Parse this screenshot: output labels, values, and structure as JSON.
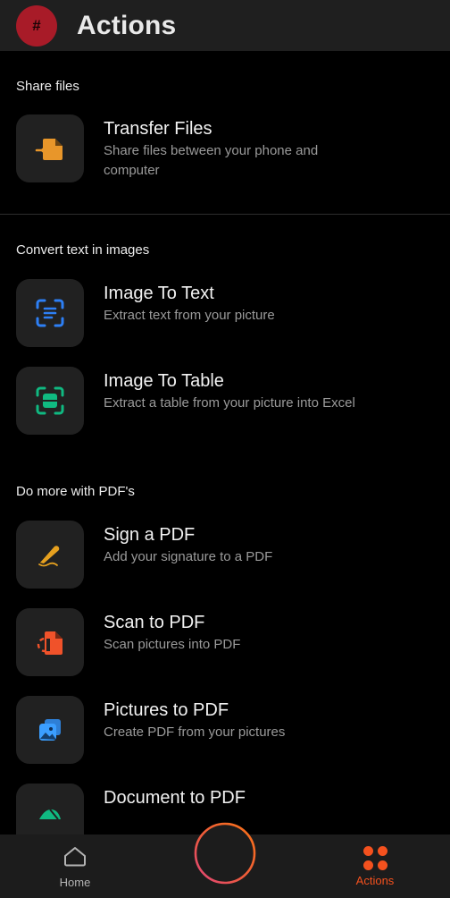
{
  "header": {
    "avatar_glyph": "#",
    "avatar_icon": "hash-avatar-icon",
    "avatar_color": "#A81B28",
    "title": "Actions"
  },
  "sections": [
    {
      "label": "Share files",
      "items": [
        {
          "title": "Transfer Files",
          "subtitle": "Share files between your phone and computer",
          "icon": "transfer-files-icon",
          "icon_color": "#E8962A"
        }
      ]
    },
    {
      "label": "Convert text in images",
      "items": [
        {
          "title": "Image To Text",
          "subtitle": "Extract text from your picture",
          "icon": "image-to-text-scan-icon",
          "icon_color": "#2D7FF5"
        },
        {
          "title": "Image To Table",
          "subtitle": "Extract a table from your picture into Excel",
          "icon": "image-to-table-scan-icon",
          "icon_color": "#10B981"
        }
      ]
    },
    {
      "label": "Do more with PDF's",
      "items": [
        {
          "title": "Sign a PDF",
          "subtitle": "Add your signature to a PDF",
          "icon": "pen-signature-icon",
          "icon_color": "#E5A01F"
        },
        {
          "title": "Scan to PDF",
          "subtitle": "Scan pictures into PDF",
          "icon": "scan-to-pdf-icon",
          "icon_color": "#F0522A"
        },
        {
          "title": "Pictures to PDF",
          "subtitle": "Create PDF from your pictures",
          "icon": "pictures-to-pdf-icon",
          "icon_color": "#3B9EFF"
        },
        {
          "title": "Document to PDF",
          "subtitle": "",
          "icon": "document-to-pdf-icon",
          "icon_color": "#10B981"
        }
      ]
    }
  ],
  "navbar": {
    "home_label": "Home",
    "home_icon": "home-icon",
    "actions_label": "Actions",
    "actions_icon": "four-dots-grid-icon",
    "active_color": "#F4511E",
    "inactive_color": "#B4B4B4",
    "fab_icon": "plus-icon",
    "fab_gradient_from": "#F97316",
    "fab_gradient_to": "#E0457B"
  }
}
